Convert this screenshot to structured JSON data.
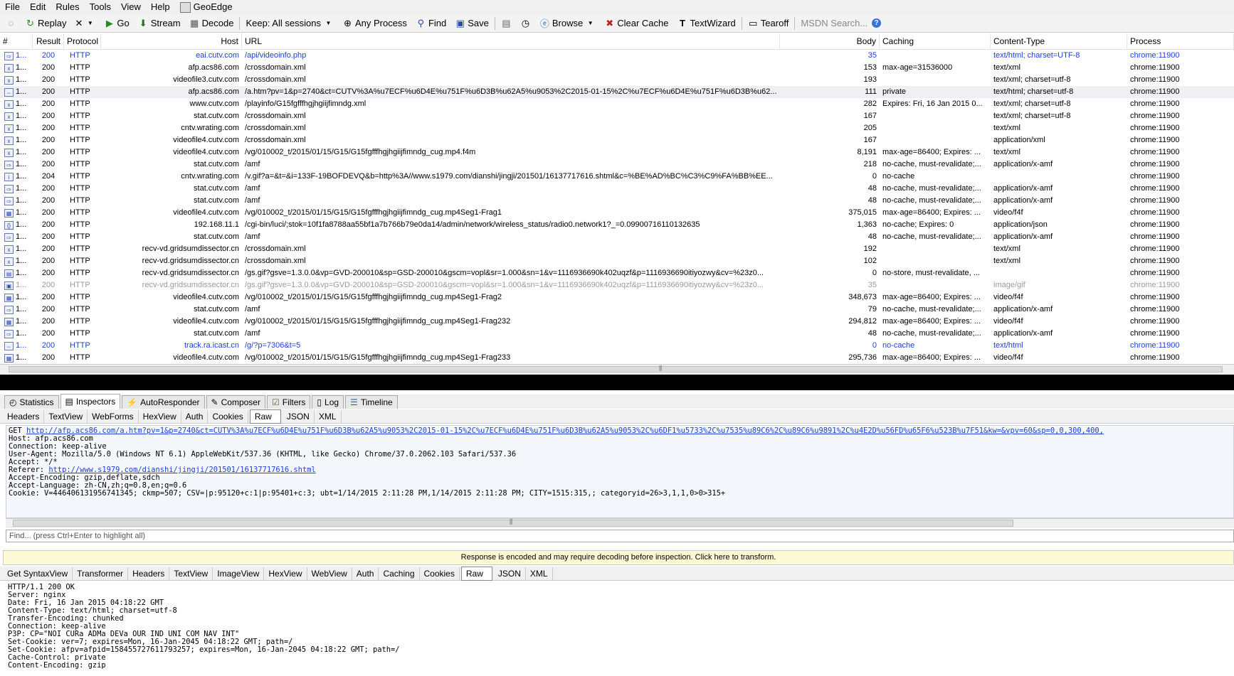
{
  "menu": [
    "File",
    "Edit",
    "Rules",
    "Tools",
    "View",
    "Help",
    "GeoEdge"
  ],
  "toolbar": {
    "replay": "Replay",
    "remove": "✕",
    "go": "Go",
    "stream": "Stream",
    "decode": "Decode",
    "keep": "Keep: All sessions",
    "process": "Any Process",
    "find": "Find",
    "save": "Save",
    "browse": "Browse",
    "clear_cache": "Clear Cache",
    "textwizard": "TextWizard",
    "tearoff": "Tearoff",
    "msdn": "MSDN Search..."
  },
  "columns": [
    "#",
    "Result",
    "Protocol",
    "Host",
    "URL",
    "Body",
    "Caching",
    "Content-Type",
    "Process"
  ],
  "sessions": [
    {
      "num": "1...",
      "result": "200",
      "protocol": "HTTP",
      "host": "eai.cutv.com",
      "url": "/api/videoinfo.php",
      "body": "35",
      "caching": "",
      "ctype": "text/html; charset=UTF-8",
      "process": "chrome:11900",
      "style": "blue",
      "icon": "⇨"
    },
    {
      "num": "1...",
      "result": "200",
      "protocol": "HTTP",
      "host": "afp.acs86.com",
      "url": "/crossdomain.xml",
      "body": "153",
      "caching": "max-age=31536000",
      "ctype": "text/xml",
      "process": "chrome:11900",
      "style": "",
      "icon": "x"
    },
    {
      "num": "1...",
      "result": "200",
      "protocol": "HTTP",
      "host": "videofile3.cutv.com",
      "url": "/crossdomain.xml",
      "body": "193",
      "caching": "",
      "ctype": "text/xml; charset=utf-8",
      "process": "chrome:11900",
      "style": "",
      "icon": "x"
    },
    {
      "num": "1...",
      "result": "200",
      "protocol": "HTTP",
      "host": "afp.acs86.com",
      "url": "/a.htm?pv=1&p=2740&ct=CUTV%3A%u7ECF%u6D4E%u751F%u6D3B%u62A5%u9053%2C2015-01-15%2C%u7ECF%u6D4E%u751F%u6D3B%u62...",
      "body": "111",
      "caching": "private",
      "ctype": "text/html; charset=utf-8",
      "process": "chrome:11900",
      "style": "sel",
      "icon": "⇔"
    },
    {
      "num": "1...",
      "result": "200",
      "protocol": "HTTP",
      "host": "www.cutv.com",
      "url": "/playinfo/G15fgfffhgjhgiijfimndg.xml",
      "body": "282",
      "caching": "Expires: Fri, 16 Jan 2015 0...",
      "ctype": "text/xml; charset=utf-8",
      "process": "chrome:11900",
      "style": "",
      "icon": "x"
    },
    {
      "num": "1...",
      "result": "200",
      "protocol": "HTTP",
      "host": "stat.cutv.com",
      "url": "/crossdomain.xml",
      "body": "167",
      "caching": "",
      "ctype": "text/xml; charset=utf-8",
      "process": "chrome:11900",
      "style": "",
      "icon": "x"
    },
    {
      "num": "1...",
      "result": "200",
      "protocol": "HTTP",
      "host": "cntv.wrating.com",
      "url": "/crossdomain.xml",
      "body": "205",
      "caching": "",
      "ctype": "text/xml",
      "process": "chrome:11900",
      "style": "",
      "icon": "x"
    },
    {
      "num": "1...",
      "result": "200",
      "protocol": "HTTP",
      "host": "videofile4.cutv.com",
      "url": "/crossdomain.xml",
      "body": "167",
      "caching": "",
      "ctype": "application/xml",
      "process": "chrome:11900",
      "style": "",
      "icon": "x"
    },
    {
      "num": "1...",
      "result": "200",
      "protocol": "HTTP",
      "host": "videofile4.cutv.com",
      "url": "/vg/010002_t/2015/01/15/G15/G15fgfffhgjhgiijfimndg_cug.mp4.f4m",
      "body": "8,191",
      "caching": "max-age=86400; Expires: ...",
      "ctype": "text/xml",
      "process": "chrome:11900",
      "style": "",
      "icon": "x"
    },
    {
      "num": "1...",
      "result": "200",
      "protocol": "HTTP",
      "host": "stat.cutv.com",
      "url": "/amf",
      "body": "218",
      "caching": "no-cache, must-revalidate;...",
      "ctype": "application/x-amf",
      "process": "chrome:11900",
      "style": "",
      "icon": "⇨"
    },
    {
      "num": "1...",
      "result": "204",
      "protocol": "HTTP",
      "host": "cntv.wrating.com",
      "url": "/v.gif?a=&t=&i=133F-19BOFDEVQ&b=http%3A//www.s1979.com/dianshi/jingji/201501/16137717616.shtml&c=%BE%AD%BC%C3%C9%FA%BB%EE...",
      "body": "0",
      "caching": "no-cache",
      "ctype": "",
      "process": "chrome:11900",
      "style": "",
      "icon": "i"
    },
    {
      "num": "1...",
      "result": "200",
      "protocol": "HTTP",
      "host": "stat.cutv.com",
      "url": "/amf",
      "body": "48",
      "caching": "no-cache, must-revalidate;...",
      "ctype": "application/x-amf",
      "process": "chrome:11900",
      "style": "",
      "icon": "⇨"
    },
    {
      "num": "1...",
      "result": "200",
      "protocol": "HTTP",
      "host": "stat.cutv.com",
      "url": "/amf",
      "body": "48",
      "caching": "no-cache, must-revalidate;...",
      "ctype": "application/x-amf",
      "process": "chrome:11900",
      "style": "",
      "icon": "⇨"
    },
    {
      "num": "1...",
      "result": "200",
      "protocol": "HTTP",
      "host": "videofile4.cutv.com",
      "url": "/vg/010002_t/2015/01/15/G15/G15fgfffhgjhgiijfimndg_cug.mp4Seg1-Frag1",
      "body": "375,015",
      "caching": "max-age=86400; Expires: ...",
      "ctype": "video/f4f",
      "process": "chrome:11900",
      "style": "",
      "icon": "▦"
    },
    {
      "num": "1...",
      "result": "200",
      "protocol": "HTTP",
      "host": "192.168.11.1",
      "url": "/cgi-bin/luci/;stok=10f1fa8788aa55bf1a7b766b79e0da14/admin/network/wireless_status/radio0.network1?_=0.09900716110132635",
      "body": "1,363",
      "caching": "no-cache; Expires: 0",
      "ctype": "application/json",
      "process": "chrome:11900",
      "style": "",
      "icon": "{}"
    },
    {
      "num": "1...",
      "result": "200",
      "protocol": "HTTP",
      "host": "stat.cutv.com",
      "url": "/amf",
      "body": "48",
      "caching": "no-cache, must-revalidate;...",
      "ctype": "application/x-amf",
      "process": "chrome:11900",
      "style": "",
      "icon": "⇨"
    },
    {
      "num": "1...",
      "result": "200",
      "protocol": "HTTP",
      "host": "recv-vd.gridsumdissector.cn",
      "url": "/crossdomain.xml",
      "body": "192",
      "caching": "",
      "ctype": "text/xml",
      "process": "chrome:11900",
      "style": "",
      "icon": "x"
    },
    {
      "num": "1...",
      "result": "200",
      "protocol": "HTTP",
      "host": "recv-vd.gridsumdissector.cn",
      "url": "/crossdomain.xml",
      "body": "102",
      "caching": "",
      "ctype": "text/xml",
      "process": "chrome:11900",
      "style": "",
      "icon": "x"
    },
    {
      "num": "1...",
      "result": "200",
      "protocol": "HTTP",
      "host": "recv-vd.gridsumdissector.cn",
      "url": "/gs.gif?gsve=1.3.0.0&vp=GVD-200010&sp=GSD-200010&gscm=vopl&sr=1.000&sn=1&v=1116936690k402uqzf&p=1116936690itiyozwy&cv=%23z0...",
      "body": "0",
      "caching": "no-store, must-revalidate, ...",
      "ctype": "",
      "process": "chrome:11900",
      "style": "",
      "icon": "▤"
    },
    {
      "num": "1...",
      "result": "200",
      "protocol": "HTTP",
      "host": "recv-vd.gridsumdissector.cn",
      "url": "/gs.gif?gsve=1.3.0.0&vp=GVD-200010&sp=GSD-200010&gscm=vopl&sr=1.000&sn=1&v=1116936690k402uqzf&p=1116936690itiyozwy&cv=%23z0...",
      "body": "35",
      "caching": "",
      "ctype": "image/gif",
      "process": "chrome:11900",
      "style": "gray",
      "icon": "▣"
    },
    {
      "num": "1...",
      "result": "200",
      "protocol": "HTTP",
      "host": "videofile4.cutv.com",
      "url": "/vg/010002_t/2015/01/15/G15/G15fgfffhgjhgiijfimndg_cug.mp4Seg1-Frag2",
      "body": "348,673",
      "caching": "max-age=86400; Expires: ...",
      "ctype": "video/f4f",
      "process": "chrome:11900",
      "style": "",
      "icon": "▦"
    },
    {
      "num": "1...",
      "result": "200",
      "protocol": "HTTP",
      "host": "stat.cutv.com",
      "url": "/amf",
      "body": "79",
      "caching": "no-cache, must-revalidate;...",
      "ctype": "application/x-amf",
      "process": "chrome:11900",
      "style": "",
      "icon": "⇨"
    },
    {
      "num": "1...",
      "result": "200",
      "protocol": "HTTP",
      "host": "videofile4.cutv.com",
      "url": "/vg/010002_t/2015/01/15/G15/G15fgfffhgjhgiijfimndg_cug.mp4Seg1-Frag232",
      "body": "294,812",
      "caching": "max-age=86400; Expires: ...",
      "ctype": "video/f4f",
      "process": "chrome:11900",
      "style": "",
      "icon": "▦"
    },
    {
      "num": "1...",
      "result": "200",
      "protocol": "HTTP",
      "host": "stat.cutv.com",
      "url": "/amf",
      "body": "48",
      "caching": "no-cache, must-revalidate;...",
      "ctype": "application/x-amf",
      "process": "chrome:11900",
      "style": "",
      "icon": "⇨"
    },
    {
      "num": "1...",
      "result": "200",
      "protocol": "HTTP",
      "host": "track.ra.icast.cn",
      "url": "/g/?p=7306&t=5",
      "body": "0",
      "caching": "no-cache",
      "ctype": "text/html",
      "process": "chrome:11900",
      "style": "blue",
      "icon": "⇔"
    },
    {
      "num": "1...",
      "result": "200",
      "protocol": "HTTP",
      "host": "videofile4.cutv.com",
      "url": "/vg/010002_t/2015/01/15/G15/G15fgfffhgjhgiijfimndg_cug.mp4Seg1-Frag233",
      "body": "295,736",
      "caching": "max-age=86400; Expires: ...",
      "ctype": "video/f4f",
      "process": "chrome:11900",
      "style": "",
      "icon": "▦"
    }
  ],
  "main_tabs": [
    "Statistics",
    "Inspectors",
    "AutoResponder",
    "Composer",
    "Filters",
    "Log",
    "Timeline"
  ],
  "request_tabs": [
    "Headers",
    "TextView",
    "WebForms",
    "HexView",
    "Auth",
    "Cookies",
    "Raw",
    "JSON",
    "XML"
  ],
  "request_lines": [
    {
      "pre": "GET ",
      "link": "http://afp.acs86.com/a.htm?pv=1&p=2740&ct=CUTV%3A%u7ECF%u6D4E%u751F%u6D3B%u62A5%u9053%2C2015-01-15%2C%u7ECF%u6D4E%u751F%u6D3B%u62A5%u9053%2C%u6DF1%u5733%2C%u7535%u89C6%2C%u89C6%u9891%2C%u4E2D%u56FD%u65F6%u523B%u7F51&kw=&vpv=60&sp=0,0,300,400,",
      "post": ""
    },
    {
      "pre": "Host: afp.acs86.com",
      "link": "",
      "post": ""
    },
    {
      "pre": "Connection: keep-alive",
      "link": "",
      "post": ""
    },
    {
      "pre": "User-Agent: Mozilla/5.0 (Windows NT 6.1) AppleWebKit/537.36 (KHTML, like Gecko) Chrome/37.0.2062.103 Safari/537.36",
      "link": "",
      "post": ""
    },
    {
      "pre": "Accept: */*",
      "link": "",
      "post": ""
    },
    {
      "pre": "Referer: ",
      "link": "http://www.s1979.com/dianshi/jingji/201501/16137717616.shtml",
      "post": ""
    },
    {
      "pre": "Accept-Encoding: gzip,deflate,sdch",
      "link": "",
      "post": ""
    },
    {
      "pre": "Accept-Language: zh-CN,zh;q=0.8,en;q=0.6",
      "link": "",
      "post": ""
    },
    {
      "pre": "Cookie: V=446406131956741345; ckmp=507; CSV=|p:95120+c:1|p:95401+c:3; ubt=1/14/2015 2:11:28 PM,1/14/2015 2:11:28 PM; CITY=1515:315,; categoryid=26>3,1,1,0>0>315+",
      "link": "",
      "post": ""
    }
  ],
  "find_placeholder": "Find... (press Ctrl+Enter to highlight all)",
  "notice": "Response is encoded and may require decoding before inspection. Click here to transform.",
  "response_tabs": [
    "Get SyntaxView",
    "Transformer",
    "Headers",
    "TextView",
    "ImageView",
    "HexView",
    "WebView",
    "Auth",
    "Caching",
    "Cookies",
    "Raw",
    "JSON",
    "XML"
  ],
  "response_lines": [
    "HTTP/1.1 200 OK",
    "Server: nginx",
    "Date: Fri, 16 Jan 2015 04:18:22 GMT",
    "Content-Type: text/html; charset=utf-8",
    "Transfer-Encoding: chunked",
    "Connection: keep-alive",
    "P3P: CP=\"NOI CURa ADMa DEVa OUR IND UNI COM NAV INT\"",
    "Set-Cookie: ver=7; expires=Mon, 16-Jan-2045 04:18:22 GMT; path=/",
    "Set-Cookie: afpv=afpid=158455727611793257; expires=Mon, 16-Jan-2045 04:18:22 GMT; path=/",
    "Cache-Control: private",
    "Content-Encoding: gzip"
  ]
}
